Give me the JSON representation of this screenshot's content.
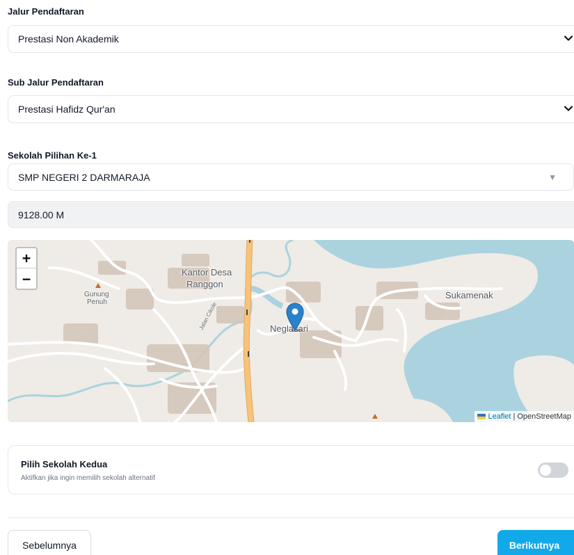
{
  "jalur": {
    "label": "Jalur Pendaftaran",
    "value": "Prestasi Non Akademik"
  },
  "sub_jalur": {
    "label": "Sub Jalur Pendaftaran",
    "value": "Prestasi Hafidz Qur'an"
  },
  "sekolah": {
    "label": "Sekolah Pilihan Ke-1",
    "value": "SMP NEGERI 2 DARMARAJA"
  },
  "distance": {
    "value": "9128.00 M"
  },
  "map": {
    "zoom_in": "+",
    "zoom_out": "−",
    "places": {
      "kantor_desa_1": "Kantor Desa",
      "kantor_desa_2": "Ranggon",
      "gunung_1": "Gunung",
      "gunung_2": "Penuh",
      "negla": "Neglasari",
      "sukamenak": "Sukamenak",
      "jalan": "Jalan Cikole"
    },
    "attribution": {
      "leaflet": "Leaflet",
      "separator": " | ",
      "osm": "OpenStreetMap"
    },
    "colors": {
      "land": "#efebe6",
      "water": "#aad3df",
      "road_major": "#f7c37a",
      "road": "#ffffff",
      "marker": "#2a81cb"
    }
  },
  "second_school": {
    "title": "Pilih Sekolah Kedua",
    "subtitle": "Aktifkan jika ingin memilih sekolah alternatif",
    "enabled": false
  },
  "nav": {
    "prev_label": "Sebelumnya",
    "next_label": "Berikutnya"
  },
  "colors": {
    "primary": "#12a9ea",
    "toggle_off": "#d1d5db"
  },
  "icons": {
    "select_caret": "chevron-down-icon",
    "combo_caret": "triangle-down-icon",
    "map_marker": "map-marker-icon"
  }
}
